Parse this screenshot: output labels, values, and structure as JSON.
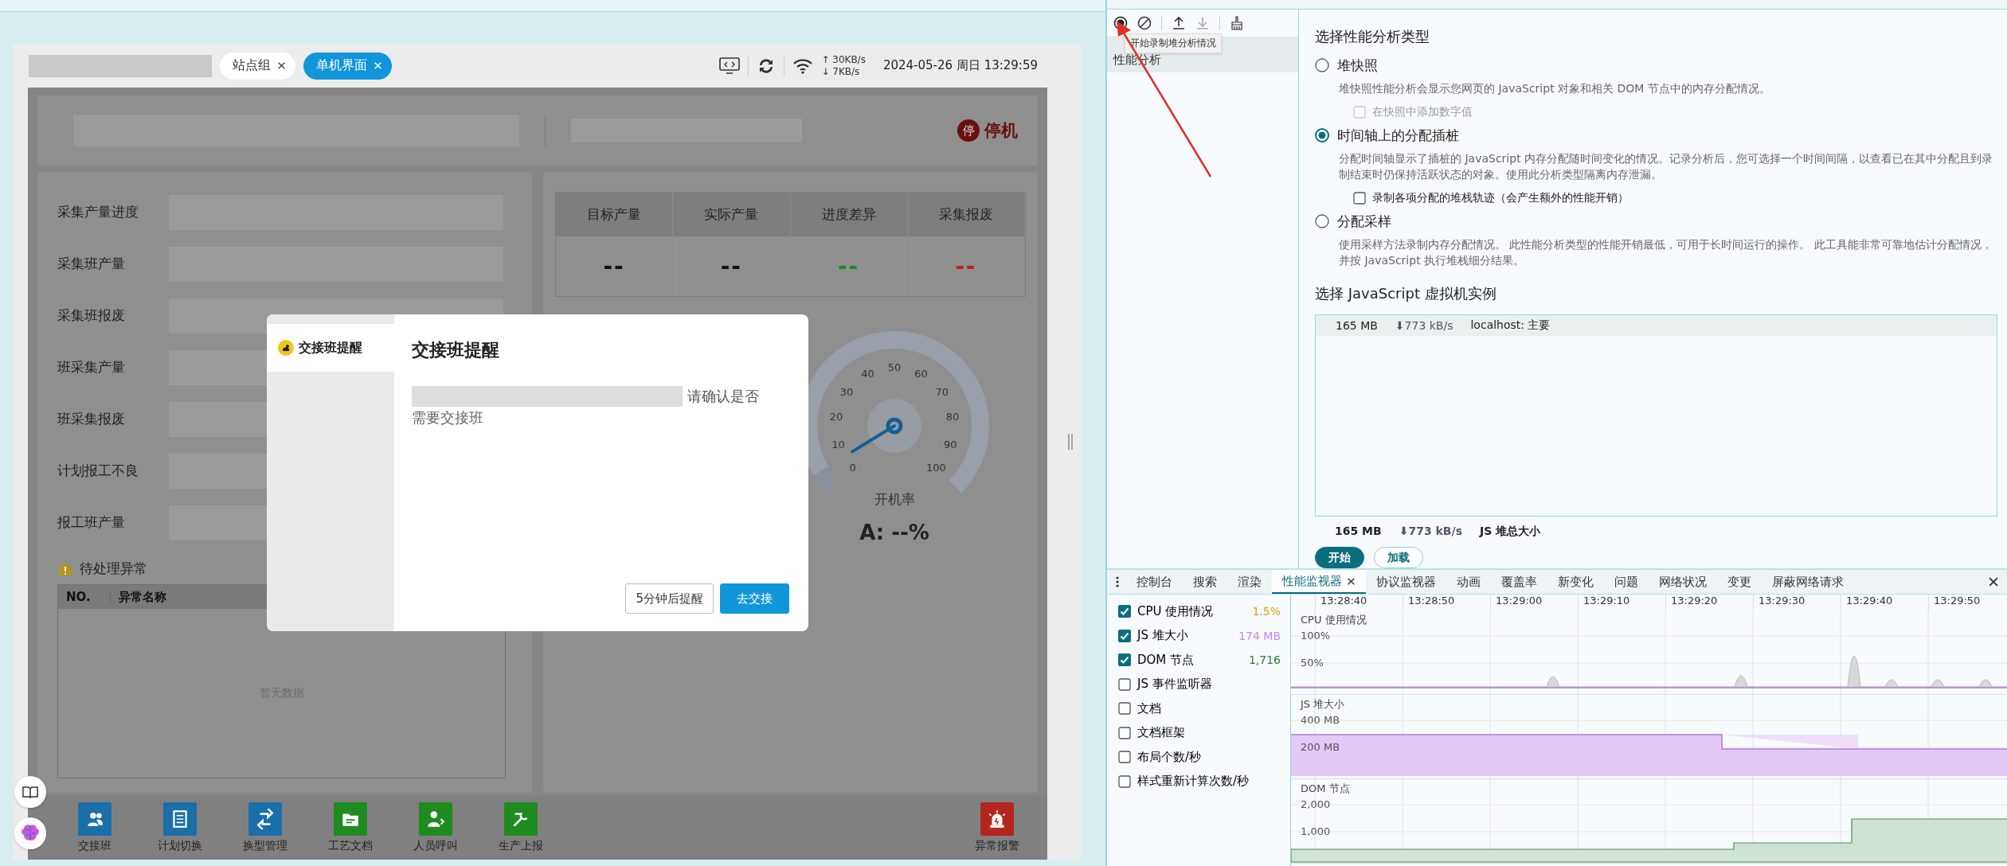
{
  "app": {
    "tabs": [
      {
        "label": "站点组",
        "selected": false
      },
      {
        "label": "单机界面",
        "selected": true
      }
    ],
    "status": {
      "upload": "↑ 30KB/s",
      "download": "↓ 7KB/s",
      "datetime": "2024-05-26 周日 13:29:59"
    },
    "machine_status": {
      "badge": "停",
      "label": "停机"
    },
    "fields": [
      "采集产量进度",
      "采集班产量",
      "采集班报废",
      "班采集产量",
      "班采集报废",
      "计划报工不良",
      "报工班产量"
    ],
    "exceptions": {
      "title": "待处理异常",
      "columns": [
        "NO.",
        "异常名称"
      ],
      "empty": "暂无数据"
    },
    "stats": [
      {
        "label": "目标产量",
        "value": "--",
        "color": "#111111"
      },
      {
        "label": "实际产量",
        "value": "--",
        "color": "#111111"
      },
      {
        "label": "进度差异",
        "value": "--",
        "color": "#1f8a1f"
      },
      {
        "label": "采集报废",
        "value": "--",
        "color": "#b3261e"
      }
    ],
    "gauge": {
      "ticks": [
        "0",
        "10",
        "20",
        "30",
        "40",
        "50",
        "60",
        "70",
        "80",
        "90",
        "100"
      ],
      "label": "开机率",
      "level": 0.05,
      "reading": "A: --%"
    },
    "toolbar": [
      {
        "label": "交接班",
        "kind": "people",
        "color": "#1a6fa8"
      },
      {
        "label": "计划切换",
        "kind": "checklist",
        "color": "#1a6fa8"
      },
      {
        "label": "换型管理",
        "kind": "swap",
        "color": "#1a6fa8"
      },
      {
        "label": "工艺文档",
        "kind": "folder",
        "color": "#1f8a1f"
      },
      {
        "label": "人员呼叫",
        "kind": "call",
        "color": "#1f8a1f"
      },
      {
        "label": "生产上报",
        "kind": "tools",
        "color": "#1f8a1f"
      },
      {
        "label": "异常报警",
        "kind": "alarm",
        "color": "#b3261e"
      }
    ]
  },
  "dialog": {
    "nav": [
      {
        "label": "交接班提醒",
        "selected": true
      }
    ],
    "title": "交接班提醒",
    "message_end": "请确认是否",
    "message_line2": "需要交接班",
    "buttons": [
      {
        "label": "5分钟后提醒",
        "kind": "secondary"
      },
      {
        "label": "去交接",
        "kind": "primary"
      }
    ]
  },
  "devtools": {
    "tooltip": "开始录制堆分析情况",
    "sidebar": [
      {
        "label": "性能分析",
        "selected": true
      }
    ],
    "heading": "选择性能分析类型",
    "options": [
      {
        "label": "堆快照",
        "selected": false,
        "description": "堆快照性能分析会显示您网页的 JavaScript 对象和相关 DOM 节点中的内存分配情况。",
        "checkbox": {
          "label": "在快照中添加数字值",
          "checked": false,
          "disabled": true
        }
      },
      {
        "label": "时间轴上的分配插桩",
        "selected": true,
        "description": "分配时间轴显示了插桩的 JavaScript 内存分配随时间变化的情况。记录分析后，您可选择一个时间间隔，以查看已在其中分配且到录制结束时仍保持活跃状态的对象。使用此分析类型隔离内存泄漏。",
        "checkbox": {
          "label": "录制各项分配的堆栈轨迹（会产生额外的性能开销）",
          "checked": false,
          "disabled": false
        }
      },
      {
        "label": "分配采样",
        "selected": false,
        "description": "使用采样方法录制内存分配情况。 此性能分析类型的性能开销最低，可用于长时间运行的操作。 此工具能非常可靠地估计分配情况，并按 JavaScript 执行堆栈细分结果。"
      }
    ],
    "vm_heading": "选择 JavaScript 虚拟机实例",
    "vm_instances": [
      {
        "size": "165 MB",
        "rate": "⬇773 kB/s",
        "name": "localhost: 主要",
        "selected": true
      }
    ],
    "summary": {
      "size": "165 MB",
      "rate": "⬇773 kB/s",
      "label": "JS 堆总大小"
    },
    "buttons": [
      {
        "label": "开始",
        "kind": "primary"
      },
      {
        "label": "加载",
        "kind": "secondary"
      }
    ]
  },
  "drawer": {
    "tabs": [
      {
        "label": "控制台",
        "selected": false
      },
      {
        "label": "搜索",
        "selected": false
      },
      {
        "label": "渲染",
        "selected": false
      },
      {
        "label": "性能监视器",
        "selected": true
      },
      {
        "label": "协议监视器",
        "selected": false
      },
      {
        "label": "动画",
        "selected": false
      },
      {
        "label": "覆盖率",
        "selected": false
      },
      {
        "label": "新变化",
        "selected": false
      },
      {
        "label": "问题",
        "selected": false
      },
      {
        "label": "网络状况",
        "selected": false
      },
      {
        "label": "变更",
        "selected": false
      },
      {
        "label": "屏蔽网络请求",
        "selected": false
      }
    ],
    "metrics": [
      {
        "label": "CPU 使用情况",
        "checked": true,
        "value": "1.5%",
        "color": "#d9a400"
      },
      {
        "label": "JS 堆大小",
        "checked": true,
        "value": "174 MB",
        "color": "#c58af0"
      },
      {
        "label": "DOM 节点",
        "checked": true,
        "value": "1,716",
        "color": "#2e7d32"
      },
      {
        "label": "JS 事件监听器",
        "checked": false
      },
      {
        "label": "文档",
        "checked": false
      },
      {
        "label": "文档框架",
        "checked": false
      },
      {
        "label": "布局个数/秒",
        "checked": false
      },
      {
        "label": "样式重新计算次数/秒",
        "checked": false
      }
    ],
    "times": [
      "13:28:40",
      "13:28:50",
      "13:29:00",
      "13:29:10",
      "13:29:20",
      "13:29:30",
      "13:29:40",
      "13:29:50"
    ],
    "panels": [
      {
        "kind": "cpu",
        "title": "CPU 使用情况",
        "ticks": [
          "100%",
          "50%"
        ]
      },
      {
        "kind": "heap",
        "title": "JS 堆大小",
        "ticks": [
          "400 MB",
          "200 MB"
        ]
      },
      {
        "kind": "dom",
        "title": "DOM 节点",
        "ticks": [
          "2,000",
          "1,000"
        ]
      }
    ]
  }
}
